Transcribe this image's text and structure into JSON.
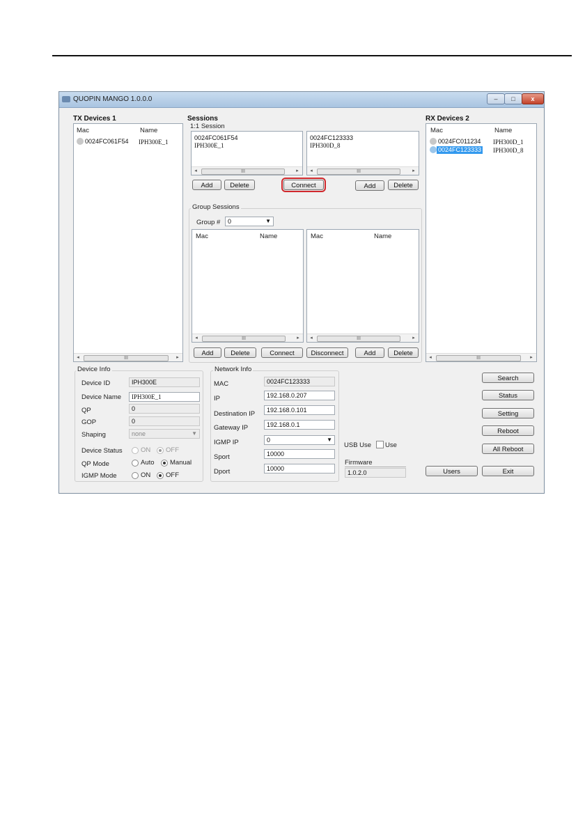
{
  "window": {
    "title": "QUOPIN MANGO 1.0.0.0"
  },
  "tx": {
    "title": "TX Devices 1",
    "col_mac": "Mac",
    "col_name": "Name",
    "rows": [
      {
        "mac": "0024FC061F54",
        "name": "IPH300E_1"
      }
    ]
  },
  "sessions": {
    "title": "Sessions",
    "one_to_one": {
      "label": "1:1 Session",
      "left_mac": "0024FC061F54",
      "left_name": "IPH300E_1",
      "right_mac": "0024FC123333",
      "right_name": "IPH300D_8",
      "add": "Add",
      "delete": "Delete",
      "connect": "Connect",
      "add2": "Add",
      "delete2": "Delete"
    },
    "group": {
      "label": "Group Sessions",
      "group_no_label": "Group #",
      "group_no_value": "0",
      "col_mac": "Mac",
      "col_name": "Name",
      "add": "Add",
      "delete": "Delete",
      "connect": "Connect",
      "disconnect": "Disconnect",
      "add2": "Add",
      "delete2": "Delete"
    }
  },
  "rx": {
    "title": "RX Devices 2",
    "col_mac": "Mac",
    "col_name": "Name",
    "rows": [
      {
        "mac": "0024FC011234",
        "name": "IPH300D_1"
      },
      {
        "mac": "0024FC123333",
        "name": "IPH300D_8"
      }
    ]
  },
  "device_info": {
    "label": "Device Info",
    "device_id_label": "Device ID",
    "device_id": "IPH300E",
    "device_name_label": "Device Name",
    "device_name": "IPH300E_1",
    "qp_label": "QP",
    "qp": "0",
    "gop_label": "GOP",
    "gop": "0",
    "shaping_label": "Shaping",
    "shaping": "none",
    "status_label": "Device Status",
    "on": "ON",
    "off": "OFF",
    "qp_mode_label": "QP Mode",
    "auto": "Auto",
    "manual": "Manual",
    "igmp_mode_label": "IGMP Mode",
    "igmp_on": "ON",
    "igmp_off": "OFF"
  },
  "network_info": {
    "label": "Network Info",
    "mac_label": "MAC",
    "mac": "0024FC123333",
    "ip_label": "IP",
    "ip": "192.168.0.207",
    "dest_ip_label": "Destination IP",
    "dest_ip": "192.168.0.101",
    "gateway_label": "Gateway IP",
    "gateway": "192.168.0.1",
    "igmp_ip_label": "IGMP IP",
    "igmp_ip": "0",
    "sport_label": "Sport",
    "sport": "10000",
    "dport_label": "Dport",
    "dport": "10000"
  },
  "usb": {
    "label": "USB Use",
    "use": "Use"
  },
  "firmware": {
    "label": "Firmware",
    "value": "1.0.2.0"
  },
  "buttons": {
    "search": "Search",
    "status": "Status",
    "setting": "Setting",
    "reboot": "Reboot",
    "all_reboot": "All Reboot",
    "users": "Users",
    "exit": "Exit"
  },
  "colors": {
    "selection": "#3399ee",
    "highlight": "#d0282c"
  }
}
